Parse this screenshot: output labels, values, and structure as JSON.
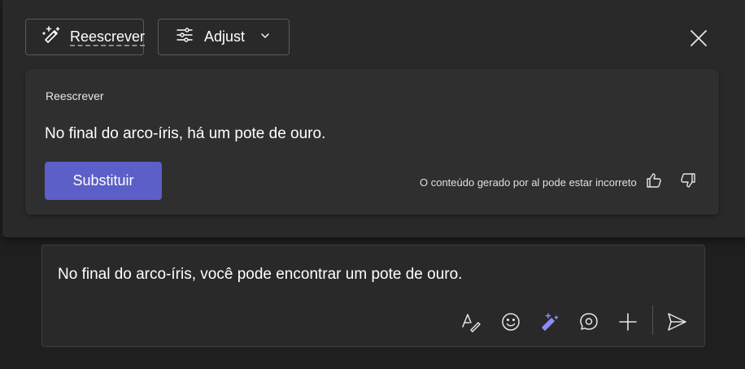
{
  "toolbar": {
    "rewrite_label": "Reescrever",
    "adjust_label": "Adjust"
  },
  "card": {
    "title": "Reescrever",
    "suggestion": "No final do arco-íris, há um pote de ouro.",
    "replace_label": "Substituir",
    "disclaimer": "O conteúdo gerado por al pode estar incorreto"
  },
  "compose": {
    "message": "No final do arco-íris, você pode encontrar um pote de ouro."
  },
  "colors": {
    "accent": "#5b5fc7",
    "copilot_icon": "#8b8cf5"
  },
  "icons": [
    "sparkle-pen-icon",
    "sliders-icon",
    "chevron-down-icon",
    "close-icon",
    "thumbs-up-icon",
    "thumbs-down-icon",
    "format-icon",
    "emoji-icon",
    "copilot-icon",
    "loop-icon",
    "plus-icon",
    "send-icon"
  ]
}
